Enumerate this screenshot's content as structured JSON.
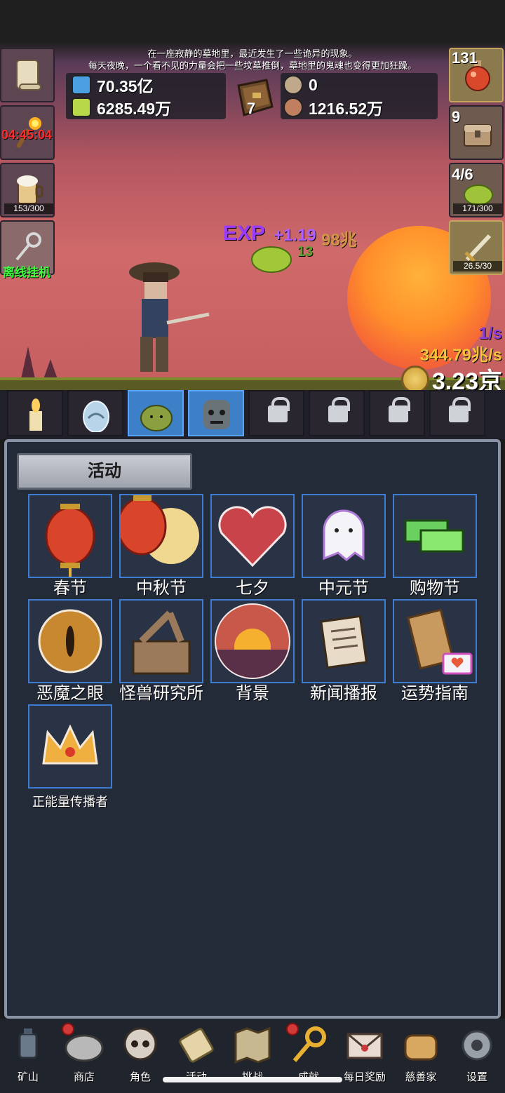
{
  "story": {
    "line1": "在一座寂静的墓地里，最近发生了一些诡异的现象。",
    "line2": "每天夜晚，一个看不见的力量会把一些坟墓推倒，墓地里的鬼魂也变得更加狂躁。"
  },
  "resources": {
    "blue_potion": "70.35亿",
    "green_potion": "6285.49万",
    "book_level": "7",
    "coin_small": "0",
    "meat": "1216.52万"
  },
  "left_buttons": {
    "scroll": "",
    "torch_timer": "04:45:04",
    "beer_progress": "153/300",
    "offline_label": "离线挂机"
  },
  "right_buttons": {
    "potion_count": "131",
    "chest_count": "9",
    "slime_count": "4/6",
    "slime_progress": "171/300",
    "sword_progress": "26.5/30"
  },
  "floating": {
    "exp": "EXP",
    "plus_exp": "+1.19",
    "money_float": "98兆",
    "num_13": "13"
  },
  "rates": {
    "per_sec_top": "1/s",
    "per_sec": "344.79兆/s",
    "total_coins": "3.23京"
  },
  "panel": {
    "tab_label": "活动",
    "items": [
      {
        "label": "春节"
      },
      {
        "label": "中秋节"
      },
      {
        "label": "七夕"
      },
      {
        "label": "中元节"
      },
      {
        "label": "购物节"
      },
      {
        "label": "恶魔之眼"
      },
      {
        "label": "怪兽研究所"
      },
      {
        "label": "背景"
      },
      {
        "label": "新闻播报"
      },
      {
        "label": "运势指南"
      },
      {
        "label": "正能量传播者"
      }
    ]
  },
  "nav": [
    {
      "label": "矿山",
      "icon": "lantern-icon"
    },
    {
      "label": "商店",
      "icon": "ore-icon"
    },
    {
      "label": "角色",
      "icon": "skull-icon"
    },
    {
      "label": "活动",
      "icon": "scroll-icon"
    },
    {
      "label": "挑战",
      "icon": "map-icon"
    },
    {
      "label": "成就",
      "icon": "key-icon"
    },
    {
      "label": "每日奖励",
      "icon": "letter-icon"
    },
    {
      "label": "慈善家",
      "icon": "bread-icon"
    },
    {
      "label": "设置",
      "icon": "gear-icon"
    }
  ],
  "colors": {
    "accent_blue": "#3d7cd1",
    "timer_red": "#ff2a2a",
    "offline_green": "#3cff3c",
    "rate_yellow": "#f5c23a",
    "exp_purple": "#9b3bff"
  }
}
